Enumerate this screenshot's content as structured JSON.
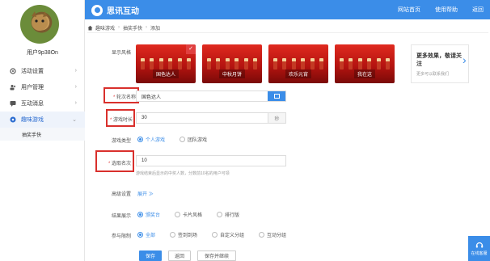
{
  "sidebar": {
    "username": "用户9p38On",
    "items": [
      {
        "label": "活动设置",
        "icon": "gear-icon"
      },
      {
        "label": "用户管理",
        "icon": "users-icon"
      },
      {
        "label": "互动消息",
        "icon": "message-icon"
      },
      {
        "label": "趣味游戏",
        "icon": "game-icon"
      }
    ],
    "sub_item": "抽奖手快"
  },
  "header": {
    "brand": "思讯互动",
    "links": [
      "网站首页",
      "使用帮助",
      "返回"
    ]
  },
  "breadcrumb": [
    "趣味游戏",
    "抽奖手快",
    "添加"
  ],
  "form": {
    "theme_label": "显示风格",
    "themes": [
      {
        "name": "国色达人",
        "selected": true
      },
      {
        "name": "中秋月饼",
        "selected": false
      },
      {
        "name": "欢乐元宵",
        "selected": false
      },
      {
        "name": "我在这",
        "selected": false
      }
    ],
    "more_title": "更多效果，敬请关注",
    "more_sub": "更多可以联系我们",
    "name_label": "轮次名称",
    "name_value": "国色达人",
    "duration_label": "游戏时长",
    "duration_value": "30",
    "duration_unit": "秒",
    "type_label": "游戏类型",
    "type_options": [
      "个人游戏",
      "团队游戏"
    ],
    "type_selected": 0,
    "winners_label": "选取名次",
    "winners_value": "10",
    "winners_hint": "游戏结束后显示的中奖人数，分数前10名的用户可领",
    "advanced_label": "高级设置",
    "advanced_link": "展开 ≫",
    "result_label": "结果展示",
    "result_options": [
      "颁奖台",
      "卡片风格",
      "排行版"
    ],
    "result_selected": 0,
    "participate_label": "参与限制",
    "participate_options": [
      "全部",
      "签到到场",
      "自定义分组",
      "互动分组"
    ],
    "participate_selected": 0,
    "save_label": "保存",
    "back_label": "返回",
    "save_continue_label": "保存并继续"
  },
  "float_service": "在线客服",
  "colors": {
    "accent": "#3b8de8",
    "highlight": "#d9302c"
  }
}
